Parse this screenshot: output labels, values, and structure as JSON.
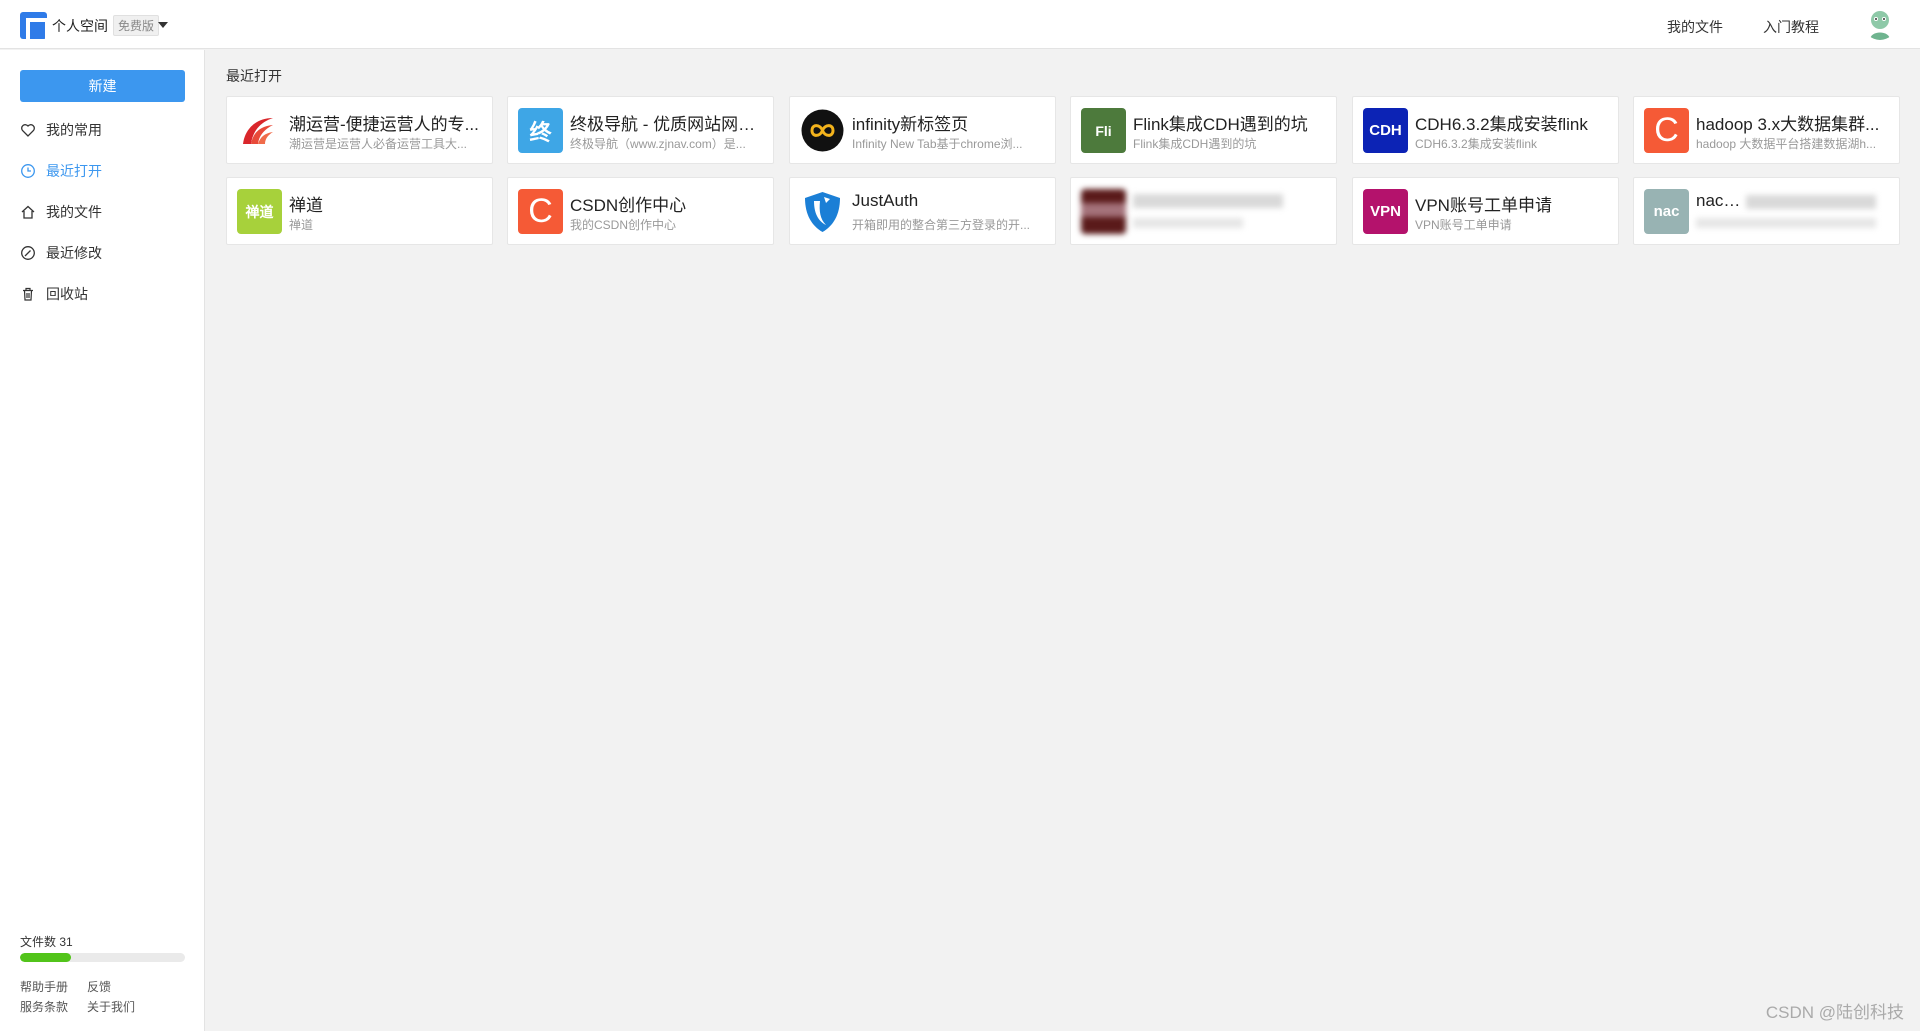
{
  "header": {
    "space_title": "个人空间",
    "plan_badge": "免费版",
    "nav": [
      "我的文件",
      "入门教程"
    ]
  },
  "sidebar": {
    "new_button": "新建",
    "items": [
      {
        "label": "我的常用",
        "icon": "heart-icon"
      },
      {
        "label": "最近打开",
        "icon": "clock-icon",
        "active": true
      },
      {
        "label": "我的文件",
        "icon": "home-icon"
      },
      {
        "label": "最近修改",
        "icon": "edit-icon"
      },
      {
        "label": "回收站",
        "icon": "trash-icon"
      }
    ],
    "file_count": "文件数 31",
    "usage_fraction": 0.31,
    "footer_links": [
      "帮助手册",
      "反馈",
      "服务条款",
      "关于我们"
    ]
  },
  "main": {
    "section_title": "最近打开",
    "cards": [
      {
        "title": "潮运营-便捷运营人的专...",
        "desc": "潮运营是运营人必备运营工具大...",
        "icon_text": "",
        "color": "#ffffff"
      },
      {
        "title": "终极导航 - 优质网站网址...",
        "desc": "终极导航（www.zjnav.com）是...",
        "icon_text": "终",
        "color": "#3ea6e6"
      },
      {
        "title": "infinity新标签页",
        "desc": "Infinity New Tab基于chrome浏...",
        "icon_text": "∞",
        "color": "#111111"
      },
      {
        "title": "Flink集成CDH遇到的坑",
        "desc": "Flink集成CDH遇到的坑",
        "icon_text": "Fli",
        "color": "#4d7a3c"
      },
      {
        "title": "CDH6.3.2集成安装flink",
        "desc": "CDH6.3.2集成安装flink",
        "icon_text": "CDH",
        "color": "#0c23b5"
      },
      {
        "title": "hadoop 3.x大数据集群...",
        "desc": "hadoop 大数据平台搭建数据湖h...",
        "icon_text": "C",
        "color": "#f55a36"
      },
      {
        "title": "禅道",
        "desc": "禅道",
        "icon_text": "禅道",
        "color": "#a7d13b"
      },
      {
        "title": "CSDN创作中心",
        "desc": "我的CSDN创作中心",
        "icon_text": "C",
        "color": "#f55a36"
      },
      {
        "title": "JustAuth",
        "desc": "开箱即用的整合第三方登录的开...",
        "icon_text": "",
        "color": "#ffffff"
      },
      {
        "title": "",
        "desc": "",
        "icon_text": "",
        "color": "#5a1a1a",
        "blurred": true
      },
      {
        "title": "VPN账号工单申请",
        "desc": "VPN账号工单申请",
        "icon_text": "VPN",
        "color": "#b4126c"
      },
      {
        "title": "nacos-",
        "desc": "",
        "icon_text": "nac",
        "color": "#98b3b3",
        "blurred_partial": true
      }
    ]
  },
  "watermark": "CSDN @陆创科技"
}
